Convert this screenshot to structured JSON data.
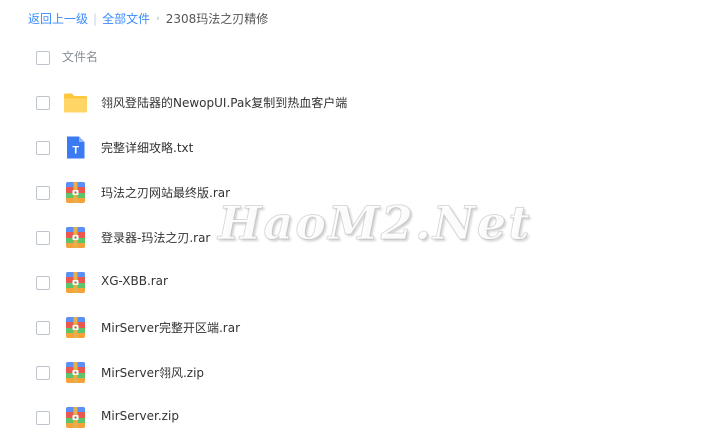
{
  "breadcrumb": {
    "back_label": "返回上一级",
    "separator": "|",
    "root_label": "全部文件",
    "arrow": "›",
    "current_label": "2308玛法之刃精修"
  },
  "list_header": {
    "column_label": "文件名"
  },
  "files": [
    {
      "name": "翎风登陆器的NewopUI.Pak复制到热血客户端",
      "icon": "folder-icon"
    },
    {
      "name": "完整详细攻略.txt",
      "icon": "text-document-icon",
      "icon_letter": "T"
    },
    {
      "name": "玛法之刃网站最终版.rar",
      "icon": "archive-icon"
    },
    {
      "name": "登录器-玛法之刃.rar",
      "icon": "archive-icon"
    },
    {
      "name": "XG-XBB.rar",
      "icon": "archive-icon"
    },
    {
      "name": "MirServer完整开区端.rar",
      "icon": "archive-icon"
    },
    {
      "name": "MirServer翎风.zip",
      "icon": "archive-icon"
    },
    {
      "name": "MirServer.zip",
      "icon": "archive-icon"
    }
  ],
  "watermark": {
    "text": "HaoM2.Net"
  },
  "colors": {
    "link": "#3b8cff",
    "folder": "#ffcc44",
    "text_doc": "#3a7bf3"
  }
}
